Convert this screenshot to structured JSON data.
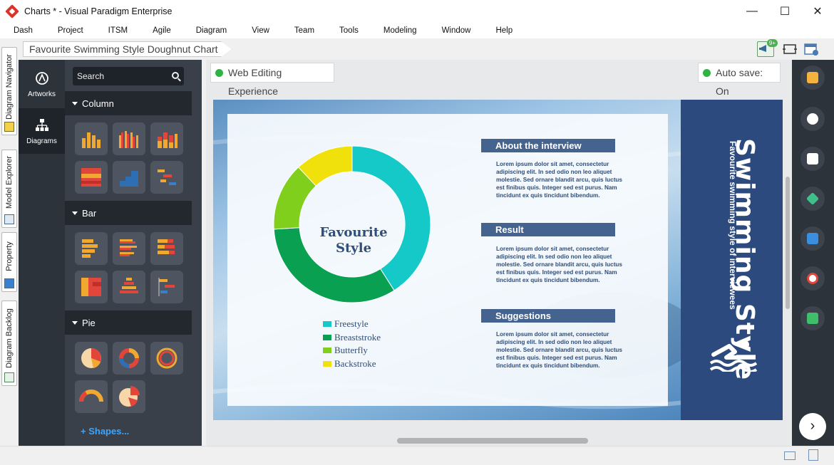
{
  "window": {
    "title": "Charts * - Visual Paradigm Enterprise",
    "minimize": "—",
    "maximize": "☐",
    "close": "✕"
  },
  "menu": [
    "Dash",
    "Project",
    "ITSM",
    "Agile",
    "Diagram",
    "View",
    "Team",
    "Tools",
    "Modeling",
    "Window",
    "Help"
  ],
  "left_tabs": [
    "Diagram Navigator",
    "Model Explorer",
    "Property",
    "Diagram Backlog"
  ],
  "breadcrumb": "Favourite Swimming Style Doughnut Chart",
  "notifications_badge": "9+",
  "nav": {
    "artworks": "Artworks",
    "diagrams": "Diagrams"
  },
  "shapes_panel": {
    "search_placeholder": "Search",
    "sections": [
      "Column",
      "Bar",
      "Pie"
    ],
    "more_link": "Shapes..."
  },
  "canvas": {
    "web_editing": "Web Editing Experience",
    "autosave": "Auto save: On"
  },
  "colors": {
    "freestyle": "#15c9c9",
    "breaststroke": "#0aa052",
    "butterfly": "#7fcf1c",
    "backstroke": "#f0e10c",
    "accent_blue": "#44638f",
    "band": "#2c4a7d"
  },
  "infographic": {
    "center_title_1": "Favourite",
    "center_title_2": "Style",
    "side_title": "Swimming Style",
    "side_subtitle": "Favourite swimming style of interviewees",
    "sections": [
      {
        "heading": "About the interview",
        "body": "Lorem ipsum dolor sit amet, consectetur adipiscing elit. In sed odio non leo aliquet molestie. Sed ornare blandit arcu, quis luctus est finibus quis. Integer sed est purus. Nam tincidunt ex quis tincidunt bibendum."
      },
      {
        "heading": "Result",
        "body": "Lorem ipsum dolor sit amet, consectetur adipiscing elit. In sed odio non leo aliquet molestie. Sed ornare blandit arcu, quis luctus est finibus quis. Integer sed est purus. Nam tincidunt ex quis tincidunt bibendum."
      },
      {
        "heading": "Suggestions",
        "body": "Lorem ipsum dolor sit amet, consectetur adipiscing elit. In sed odio non leo aliquet molestie. Sed ornare blandit arcu, quis luctus est finibus quis. Integer sed est purus. Nam tincidunt ex quis tincidunt bibendum."
      }
    ]
  },
  "chart_data": {
    "type": "pie",
    "title": "Favourite Style",
    "categories": [
      "Freestyle",
      "Breaststroke",
      "Butterfly",
      "Backstroke"
    ],
    "values": [
      41,
      33,
      14,
      12
    ],
    "colors": [
      "#15c9c9",
      "#0aa052",
      "#7fcf1c",
      "#f0e10c"
    ],
    "legend": "bottom"
  },
  "icons": {
    "right_tools": [
      "format-painter-icon",
      "zoom-icon",
      "layout-icon",
      "layers-icon",
      "panels-icon",
      "history-icon",
      "comment-icon"
    ],
    "next": "›"
  }
}
